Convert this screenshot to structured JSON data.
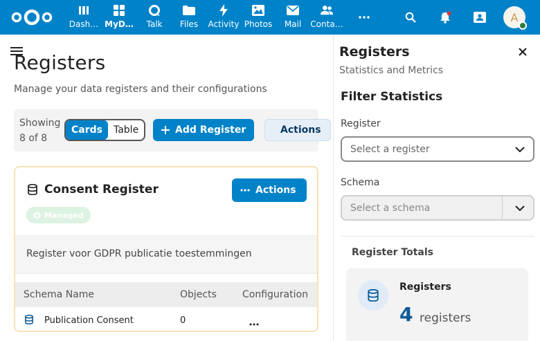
{
  "header": {
    "apps": [
      {
        "label": "Dash…",
        "icon": "dashboard-icon"
      },
      {
        "label": "MyD…",
        "icon": "mydash-icon",
        "active": true
      },
      {
        "label": "Talk",
        "icon": "talk-icon"
      },
      {
        "label": "Files",
        "icon": "folder-icon"
      },
      {
        "label": "Activity",
        "icon": "activity-icon"
      },
      {
        "label": "Photos",
        "icon": "photos-icon"
      },
      {
        "label": "Mail",
        "icon": "mail-icon"
      },
      {
        "label": "Conta…",
        "icon": "contacts-icon"
      }
    ],
    "avatar_initial": "A",
    "brand_color": "#0082c9"
  },
  "main": {
    "title": "Registers",
    "subtitle": "Manage your data registers and their configurations",
    "showing_line1": "Showing",
    "showing_line2": "8 of 8",
    "view_cards": "Cards",
    "view_table": "Table",
    "add_register": "Add Register",
    "actions": "Actions"
  },
  "card": {
    "title": "Consent Register",
    "actions": "Actions",
    "badge": "Managed",
    "description": "Register voor GDPR publicatie toestemmingen",
    "columns": [
      "Schema Name",
      "Objects",
      "Configuration"
    ],
    "rows": [
      {
        "name": "Publication Consent",
        "objects": "0"
      }
    ]
  },
  "sidebar": {
    "title": "Registers",
    "subtitle": "Statistics and Metrics",
    "filter_title": "Filter Statistics",
    "register_label": "Register",
    "register_placeholder": "Select a register",
    "schema_label": "Schema",
    "schema_placeholder": "Select a schema",
    "totals_title": "Register Totals",
    "stat_name": "Registers",
    "stat_value": "4",
    "stat_unit": "registers"
  }
}
